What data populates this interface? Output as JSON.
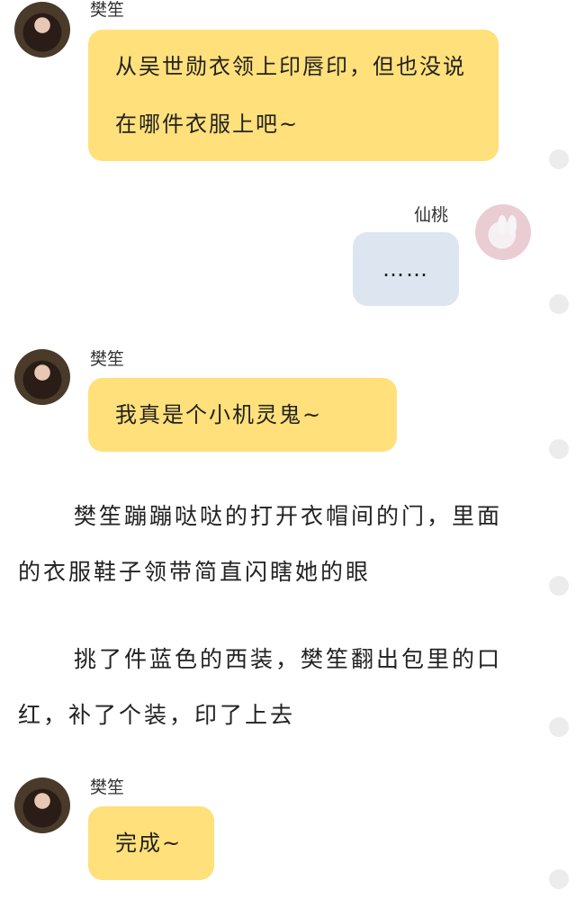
{
  "messages": [
    {
      "sender": "樊笙",
      "text": "从吴世勋衣领上印唇印，但也没说在哪件衣服上吧~"
    },
    {
      "sender": "仙桃",
      "text": "……"
    },
    {
      "sender": "樊笙",
      "text": "我真是个小机灵鬼~"
    },
    {
      "sender": "樊笙",
      "text": "完成~"
    }
  ],
  "narration": [
    "樊笙蹦蹦哒哒的打开衣帽间的门，里面的衣服鞋子领带简直闪瞎她的眼",
    "挑了件蓝色的西装，樊笙翻出包里的口红，补了个装，印了上去"
  ],
  "colors": {
    "left_bubble": "#ffe07a",
    "right_bubble": "#dde6f0",
    "scroll_dot": "#ececec"
  },
  "icons": {
    "left_avatar": "avatar-girl-long-hair",
    "right_avatar": "avatar-white-rabbit"
  }
}
